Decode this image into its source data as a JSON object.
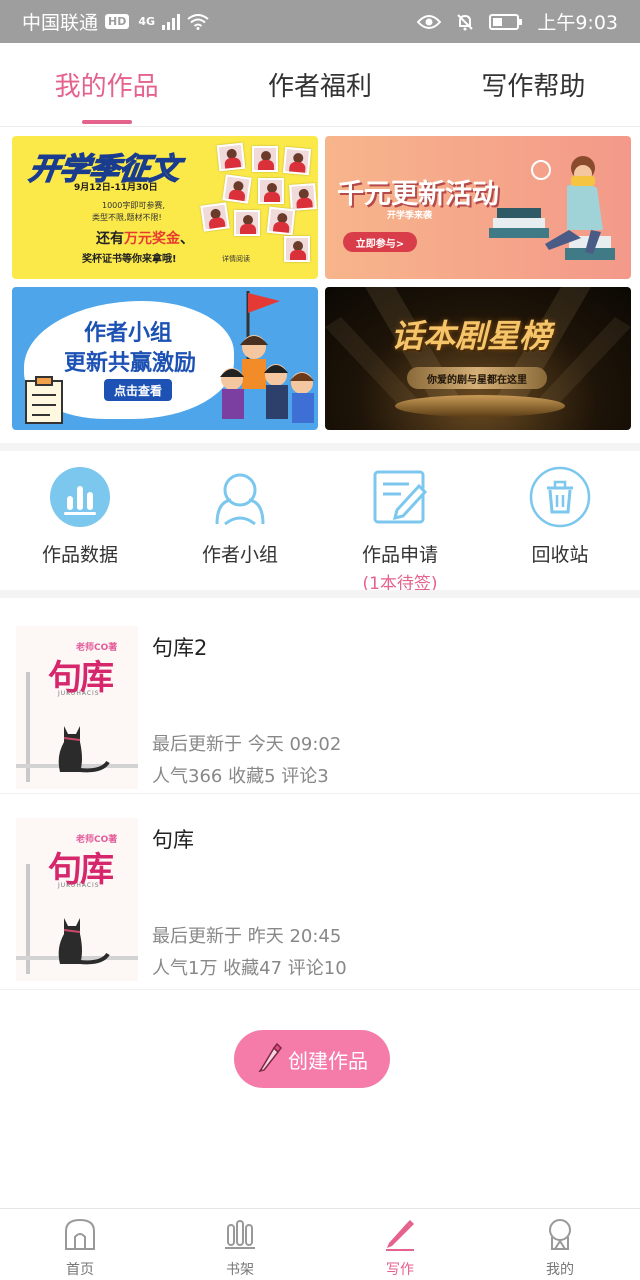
{
  "status_bar": {
    "carrier": "中国联通",
    "hd": "HD",
    "network": "4G",
    "time": "上午9:03"
  },
  "top_tabs": [
    {
      "label": "我的作品",
      "active": true
    },
    {
      "label": "作者福利",
      "active": false
    },
    {
      "label": "写作帮助",
      "active": false
    }
  ],
  "banners": {
    "b1": {
      "title": "开学季征文",
      "date": "9月12日-11月30日",
      "desc1": "1000字即可参赛,",
      "desc2": "类型不限,题材不限!",
      "prize_prefix": "还有",
      "prize_highlight": "万元奖金",
      "prize_suffix": "、",
      "desc3": "奖杯证书等你来拿哦!",
      "sponsor": "详情阅读"
    },
    "b2": {
      "title": "千元更新活动",
      "sub": "开学季来袭",
      "button": "立即参与>"
    },
    "b3": {
      "line1": "作者小组",
      "line2": "更新共赢激励",
      "button": "点击查看"
    },
    "b4": {
      "title": "话本剧星榜",
      "sub": "你爱的剧与星都在这里"
    }
  },
  "actions": [
    {
      "label": "作品数据",
      "icon": "bar-chart-icon"
    },
    {
      "label": "作者小组",
      "icon": "group-icon"
    },
    {
      "label": "作品申请",
      "sub": "(1本待签)",
      "icon": "edit-note-icon"
    },
    {
      "label": "回收站",
      "icon": "trash-icon"
    }
  ],
  "works": [
    {
      "title": "句库2",
      "updated": "最后更新于 今天 09:02",
      "stats": "人气366 收藏5 评论3",
      "cover": {
        "author": "老师CO著",
        "title": "句库",
        "sub": "JUKUHACIS"
      }
    },
    {
      "title": "句库",
      "updated": "最后更新于 昨天 20:45",
      "stats": "人气1万 收藏47 评论10",
      "cover": {
        "author": "老师CO著",
        "title": "句库",
        "sub": "JUKUHACIS"
      }
    }
  ],
  "create_button": "创建作品",
  "bottom_nav": [
    {
      "label": "首页",
      "icon": "home-icon",
      "active": false
    },
    {
      "label": "书架",
      "icon": "bookshelf-icon",
      "active": false
    },
    {
      "label": "写作",
      "icon": "pen-icon",
      "active": true
    },
    {
      "label": "我的",
      "icon": "profile-icon",
      "active": false
    }
  ],
  "colors": {
    "accent": "#e5628c",
    "button": "#f57ba8",
    "icon_blue": "#7cc7ee"
  }
}
